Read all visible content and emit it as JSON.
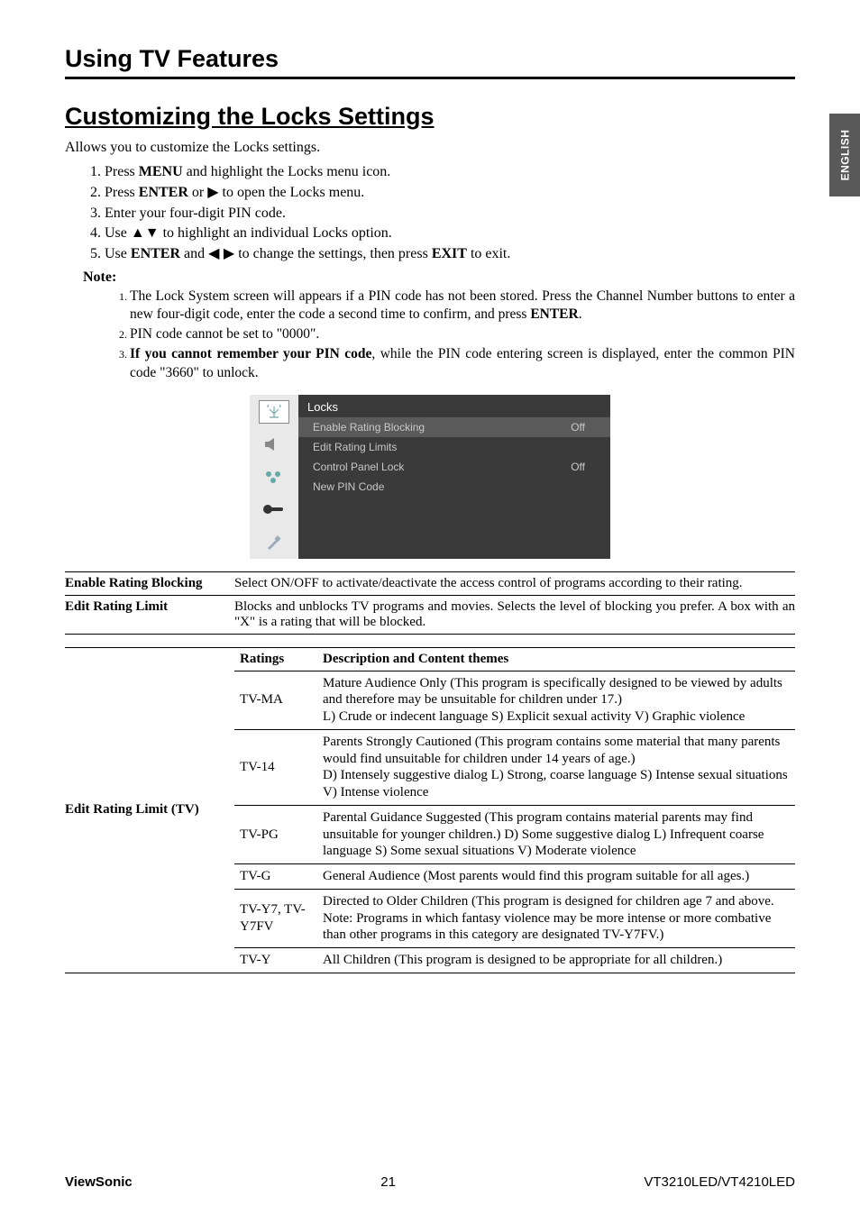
{
  "side_tab": "ENGLISH",
  "chapter_title": "Using TV Features",
  "section_title": "Customizing the Locks Settings",
  "intro": "Allows you to customize the Locks settings.",
  "steps": {
    "s1_a": "Press ",
    "s1_b": "MENU",
    "s1_c": " and highlight the Locks menu icon.",
    "s2_a": "Press ",
    "s2_b": "ENTER",
    "s2_c": " or ",
    "s2_d": "▶",
    "s2_e": " to open the Locks menu.",
    "s3": "Enter your four-digit PIN code.",
    "s4_a": "Use ",
    "s4_b": "▲▼",
    "s4_c": " to highlight an individual Locks option.",
    "s5_a": "Use ",
    "s5_b": "ENTER",
    "s5_c": " and ",
    "s5_d": "◀ ▶",
    "s5_e": " to change the settings, then press ",
    "s5_f": "EXIT",
    "s5_g": " to exit."
  },
  "note_label": "Note:",
  "notes": {
    "n1_a": "The Lock System screen will appears if a PIN code has not been stored. Press the Channel Number buttons to enter a new four-digit code, enter the code a second time to confirm, and press ",
    "n1_b": "ENTER",
    "n1_c": ".",
    "n2": "PIN code cannot be set to \"0000\".",
    "n3_a": "If you cannot remember your PIN code",
    "n3_b": ", while the PIN code entering screen is displayed, enter the common PIN code \"3660\" to unlock."
  },
  "menu": {
    "title": "Locks",
    "rows": [
      {
        "label": "Enable Rating Blocking",
        "value": "Off",
        "sel": true
      },
      {
        "label": "Edit Rating Limits",
        "value": "",
        "sel": false
      },
      {
        "label": "Control Panel Lock",
        "value": "Off",
        "sel": false
      },
      {
        "label": "New PIN Code",
        "value": "",
        "sel": false
      }
    ]
  },
  "defs": [
    {
      "label": "Enable Rating Blocking",
      "body": "Select ON/OFF to activate/deactivate the access control of programs according to their rating."
    },
    {
      "label": "Edit Rating Limit",
      "body": "Blocks and unblocks TV programs and movies. Selects the level of blocking you prefer. A box with an \"X\" is a rating that will be blocked."
    }
  ],
  "ratings_section_label": "Edit Rating Limit (TV)",
  "ratings_header": {
    "c1": "Ratings",
    "c2": "Description and Content themes"
  },
  "ratings": [
    {
      "rating": "TV-MA",
      "desc": "Mature Audience Only (This program is specifically designed to be viewed by adults and therefore may be unsuitable for children under 17.)\nL) Crude or indecent language S) Explicit sexual activity V) Graphic violence"
    },
    {
      "rating": "TV-14",
      "desc": "Parents Strongly Cautioned (This program contains some material that many parents would find unsuitable for children under 14 years of age.)\nD) Intensely suggestive dialog L) Strong, coarse language S) Intense sexual situations V) Intense violence"
    },
    {
      "rating": "TV-PG",
      "desc": "Parental Guidance Suggested (This program contains material parents may find unsuitable for younger children.) D) Some suggestive dialog L) Infrequent coarse language S) Some sexual situations V) Moderate violence"
    },
    {
      "rating": "TV-G",
      "desc": "General Audience (Most parents would find this program suitable for all ages.)"
    },
    {
      "rating": "TV-Y7, TV-Y7FV",
      "desc": "Directed to Older Children (This program is designed for children age 7 and above. Note: Programs in which fantasy violence may be more intense or more combative than other programs in this category are designated TV-Y7FV.)"
    },
    {
      "rating": "TV-Y",
      "desc": "All Children (This program is designed to be appropriate for all children.)"
    }
  ],
  "footer": {
    "brand": "ViewSonic",
    "page": "21",
    "model": "VT3210LED/VT4210LED"
  }
}
